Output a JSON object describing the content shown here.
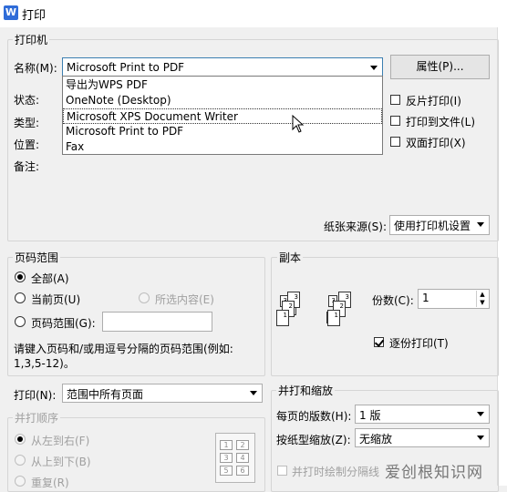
{
  "window": {
    "title": "打印",
    "app_icon_letter": "W"
  },
  "printer_group": {
    "title": "打印机",
    "name_label": "名称(M):",
    "selected_printer": "Microsoft Print to PDF",
    "properties_button": "属性(P)...",
    "status_label": "状态:",
    "type_label": "类型:",
    "location_label": "位置:",
    "comment_label": "备注:",
    "options": {
      "reverse": "反片打印(I)",
      "to_file": "打印到文件(L)",
      "duplex": "双面打印(X)"
    },
    "paper_source_label": "纸张来源(S):",
    "paper_source_value": "使用打印机设置",
    "dropdown_items": [
      "导出为WPS PDF",
      "OneNote (Desktop)",
      "Microsoft XPS Document Writer",
      "Microsoft Print to PDF",
      "Fax"
    ]
  },
  "page_range": {
    "title": "页码范围",
    "all": "全部(A)",
    "current": "当前页(U)",
    "selection": "所选内容(E)",
    "pages": "页码范围(G):",
    "hint": "请键入页码和/或用逗号分隔的页码范围(例如:",
    "hint2": "1,3,5-12)。"
  },
  "copies": {
    "title": "副本",
    "count_label": "份数(C):",
    "count_value": "1",
    "collate": "逐份打印(T)"
  },
  "print_what": {
    "label": "打印(N):",
    "value": "范围中所有页面"
  },
  "order": {
    "title": "并打顺序",
    "left_to_right": "从左到右(F)",
    "top_to_bottom": "从上到下(B)",
    "repeat": "重复(R)",
    "grid": [
      "1",
      "2",
      "3",
      "4",
      "5",
      "6"
    ]
  },
  "zoom": {
    "title": "并打和缩放",
    "per_page_label": "每页的版数(H):",
    "per_page_value": "1 版",
    "scale_label": "按纸型缩放(Z):",
    "scale_value": "无缩放",
    "draw_borders": "并打时绘制分隔线"
  },
  "watermark": "爱创根知识网"
}
